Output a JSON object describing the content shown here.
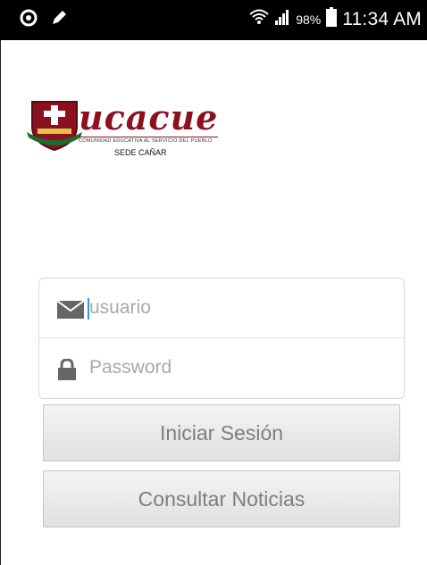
{
  "status_bar": {
    "battery_percent": "98%",
    "time": "11:34 AM",
    "icons": [
      "circle-notification-icon",
      "pen-icon",
      "wifi-icon",
      "signal-icon",
      "battery-icon"
    ]
  },
  "logo": {
    "wordmark": "ucacue",
    "tagline": "COMUNIDAD EDUCATIVA AL SERVICIO DEL PUEBLO",
    "campus": "SEDE CAÑAR",
    "brand_color": "#8b1020"
  },
  "login_form": {
    "username": {
      "value": "",
      "placeholder": "usuario",
      "icon": "envelope-icon"
    },
    "password": {
      "value": "",
      "placeholder": "Password",
      "icon": "lock-icon"
    }
  },
  "buttons": {
    "login_label": "Iniciar Sesión",
    "news_label": "Consultar Noticias"
  }
}
